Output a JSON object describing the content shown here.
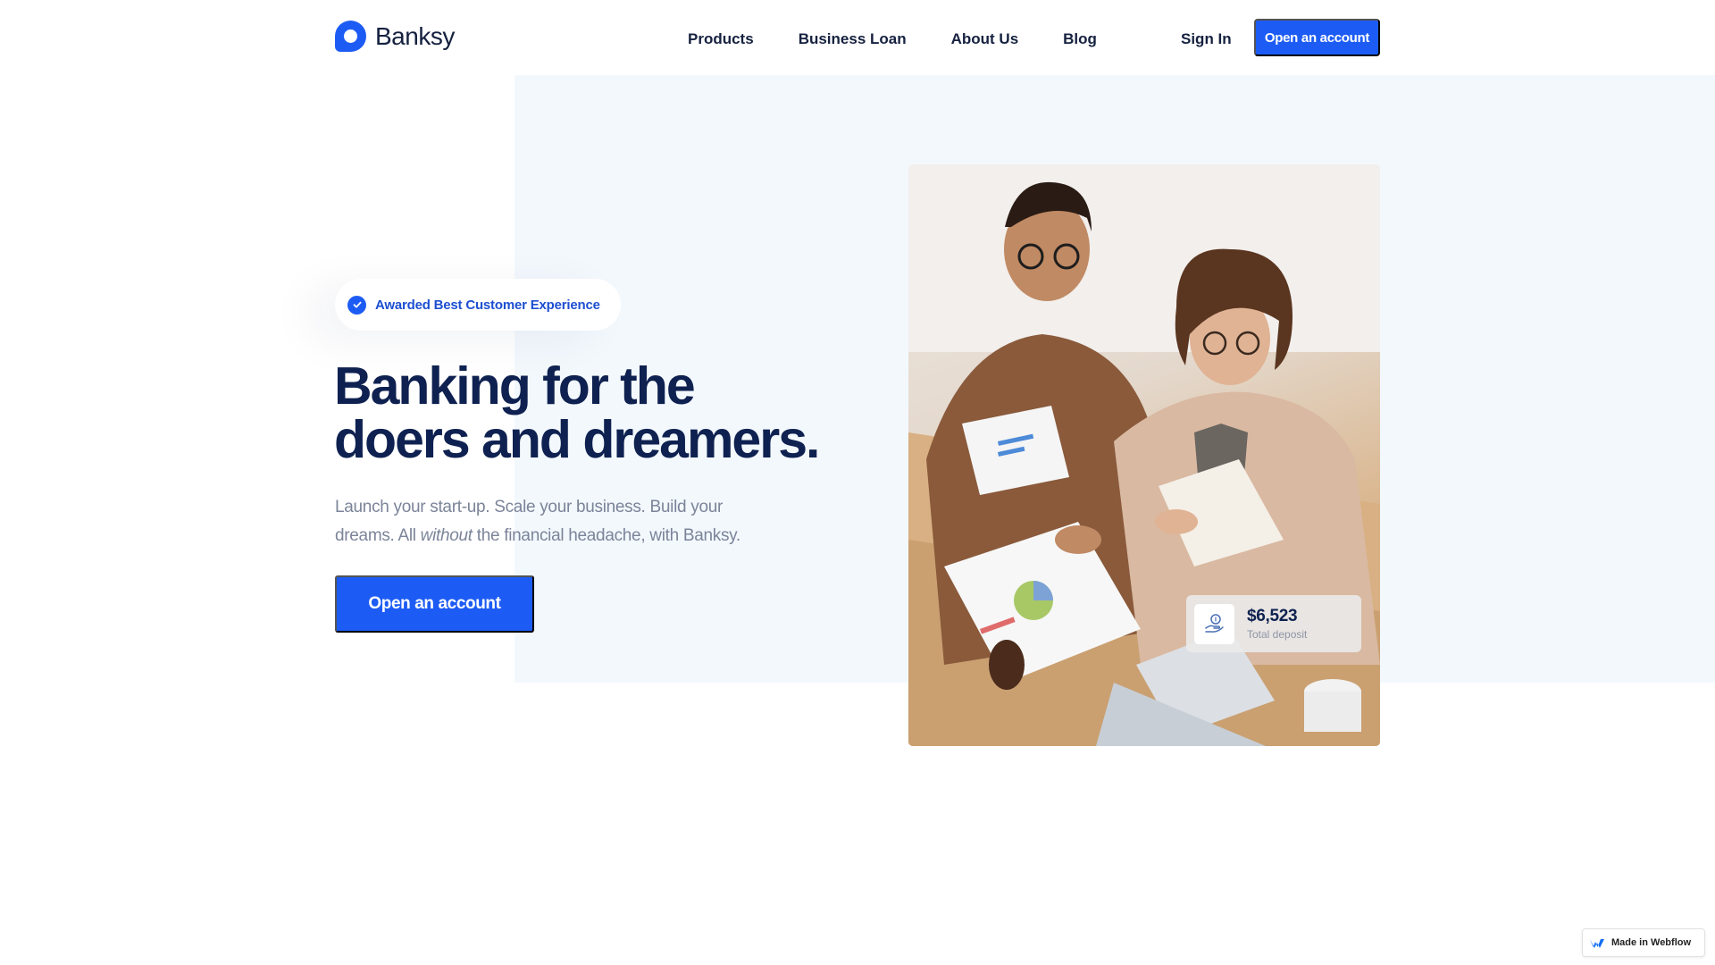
{
  "brand": {
    "name": "Banksy",
    "accent": "#1d5cf4",
    "text_dark": "#0e2150"
  },
  "nav": {
    "links": [
      "Products",
      "Business Loan",
      "About Us",
      "Blog"
    ],
    "sign_in": "Sign In",
    "cta": "Open an account"
  },
  "hero": {
    "badge": "Awarded Best Customer Experience",
    "headline_line1": "Banking for the",
    "headline_line2": "doers and dreamers.",
    "subtext_part1": "Launch your start-up. Scale your business. Build your dreams. All",
    "subtext_emphasis": "without",
    "subtext_part2": "the financial headache, with Banksy.",
    "cta": "Open an account"
  },
  "deposit_card": {
    "amount": "$6,523",
    "label": "Total deposit",
    "icon": "hand-coin-icon"
  },
  "footer_badge": {
    "label": "Made in Webflow",
    "icon": "webflow-logo-icon"
  }
}
